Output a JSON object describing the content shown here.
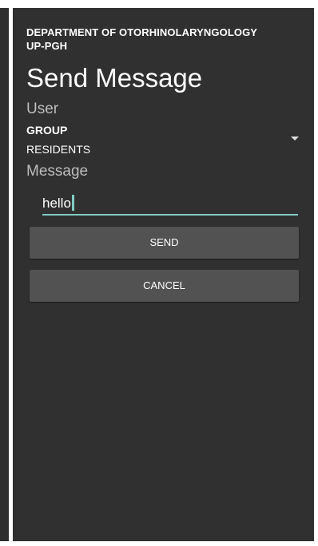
{
  "header": {
    "department_line1": "DEPARTMENT OF OTORHINOLARYNGOLOGY",
    "department_line2": "UP-PGH",
    "title": "Send Message"
  },
  "form": {
    "user_label": "User",
    "recipient_spinner": {
      "primary": "GROUP",
      "secondary": "RESIDENTS",
      "icon": "dropdown-triangle-icon"
    },
    "message_label": "Message",
    "message_value": "hello"
  },
  "actions": {
    "send_label": "SEND",
    "cancel_label": "CANCEL"
  },
  "colors": {
    "background": "#303030",
    "accent": "#80cbc4",
    "button": "#525252"
  }
}
